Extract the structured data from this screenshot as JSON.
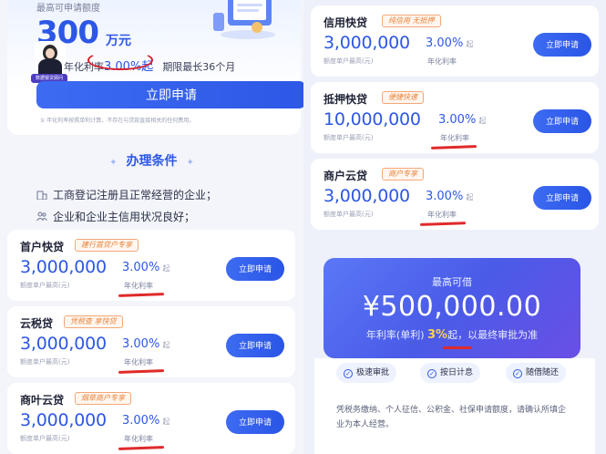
{
  "hero": {
    "label": "最高可申请额度",
    "amount": "300",
    "unit": "万元",
    "rate_prefix": "年化利率",
    "rate_value": "3.00%起",
    "term": "期限最长36个月",
    "avatar_tag": "数据银贷顾问",
    "apply_label": "立即申请",
    "note": "① 年化利率按照单利计算，不存在与贷款直接相关的任何费用。"
  },
  "conditions": {
    "title": "办理条件",
    "items": [
      "工商登记注册且正常经营的企业；",
      "企业和企业主信用状况良好；"
    ]
  },
  "products_left": [
    {
      "name": "首户快贷",
      "tag": "建行首贷户专享",
      "amount": "3,000,000",
      "limit_label": "额度单户最高(元)",
      "rate": "3.00%",
      "rate_suffix": "起",
      "rate_label": "年化利率",
      "button": "立即申请"
    },
    {
      "name": "云税贷",
      "tag": "凭税查 享快贷",
      "amount": "3,000,000",
      "limit_label": "额度单户最高(元)",
      "rate": "3.00%",
      "rate_suffix": "起",
      "rate_label": "年化利率",
      "button": "立即申请"
    },
    {
      "name": "商叶云贷",
      "tag": "烟草商户专享",
      "amount": "3,000,000",
      "limit_label": "额度单户最高(元)",
      "rate": "3.00%",
      "rate_suffix": "起",
      "rate_label": "年化利率",
      "button": "立即申请"
    }
  ],
  "products_right": [
    {
      "name": "信用快贷",
      "tag": "纯信用 无抵押",
      "amount": "3,000,000",
      "limit_label": "额度单户最高(元)",
      "rate": "3.00%",
      "rate_suffix": "起",
      "rate_label": "年化利率",
      "button": "立即申请"
    },
    {
      "name": "抵押快贷",
      "tag": "便捷快速",
      "amount": "10,000,000",
      "limit_label": "额度单户最高(元)",
      "rate": "3.00%",
      "rate_suffix": "起",
      "rate_label": "年化利率",
      "button": "立即申请"
    },
    {
      "name": "商户云贷",
      "tag": "商户专享",
      "amount": "3,000,000",
      "limit_label": "额度单户最高(元)",
      "rate": "3.00%",
      "rate_suffix": "起",
      "rate_label": "年化利率",
      "button": "立即申请"
    }
  ],
  "borrow": {
    "title": "最高可借",
    "amount": "¥500,000.00",
    "rate_prefix": "年利率(单利)",
    "rate_value": "3%",
    "rate_suffix": "起，以最终审批为准",
    "features": [
      "极速审批",
      "按日计息",
      "随借随还"
    ],
    "description": "凭税务缴纳、个人征信、公积金、社保申请额度，请确认所填企业为本人经营。"
  },
  "colors": {
    "brand_blue": "#2d57e6",
    "annotation_red": "#d7202a",
    "tag_orange": "#e8833a"
  }
}
